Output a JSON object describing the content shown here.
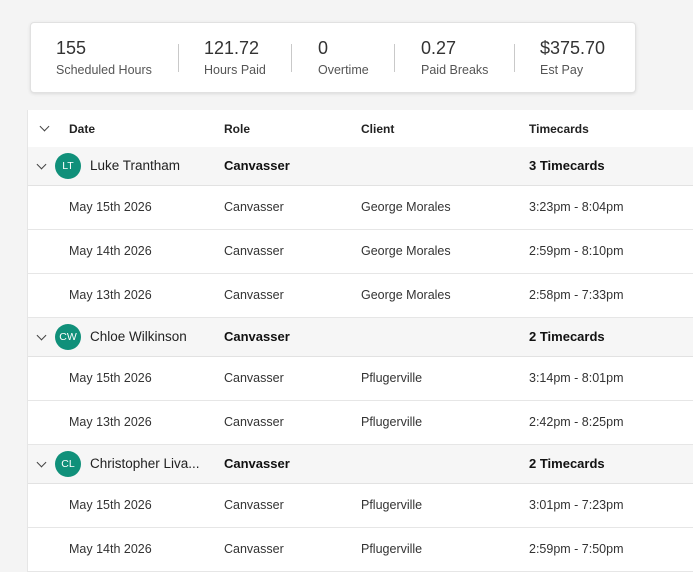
{
  "summary": {
    "stats": [
      {
        "value": "155",
        "label": "Scheduled Hours"
      },
      {
        "value": "121.72",
        "label": "Hours Paid"
      },
      {
        "value": "0",
        "label": "Overtime"
      },
      {
        "value": "0.27",
        "label": "Paid Breaks"
      },
      {
        "value": "$375.70",
        "label": "Est Pay"
      }
    ]
  },
  "table": {
    "columns": [
      "Date",
      "Role",
      "Client",
      "Timecards"
    ],
    "groups": [
      {
        "initials": "LT",
        "name": "Luke Trantham",
        "role": "Canvasser",
        "timecards": "3 Timecards",
        "rows": [
          {
            "date": "May 15th 2026",
            "role": "Canvasser",
            "client": "George Morales",
            "time": "3:23pm - 8:04pm"
          },
          {
            "date": "May 14th 2026",
            "role": "Canvasser",
            "client": "George Morales",
            "time": "2:59pm - 8:10pm"
          },
          {
            "date": "May 13th 2026",
            "role": "Canvasser",
            "client": "George Morales",
            "time": "2:58pm - 7:33pm"
          }
        ]
      },
      {
        "initials": "CW",
        "name": "Chloe Wilkinson",
        "role": "Canvasser",
        "timecards": "2 Timecards",
        "rows": [
          {
            "date": "May 15th 2026",
            "role": "Canvasser",
            "client": "Pflugerville",
            "time": "3:14pm - 8:01pm"
          },
          {
            "date": "May 13th 2026",
            "role": "Canvasser",
            "client": "Pflugerville",
            "time": "2:42pm - 8:25pm"
          }
        ]
      },
      {
        "initials": "CL",
        "name": "Christopher Liva...",
        "role": "Canvasser",
        "timecards": "2 Timecards",
        "rows": [
          {
            "date": "May 15th 2026",
            "role": "Canvasser",
            "client": "Pflugerville",
            "time": "3:01pm - 7:23pm"
          },
          {
            "date": "May 14th 2026",
            "role": "Canvasser",
            "client": "Pflugerville",
            "time": "2:59pm - 7:50pm"
          }
        ]
      }
    ]
  },
  "colors": {
    "avatar": "#10907a",
    "group_bg": "#f6f6f6",
    "page_bg": "#f4f4f4"
  },
  "icons": {
    "expand": "chevron-down-icon"
  }
}
